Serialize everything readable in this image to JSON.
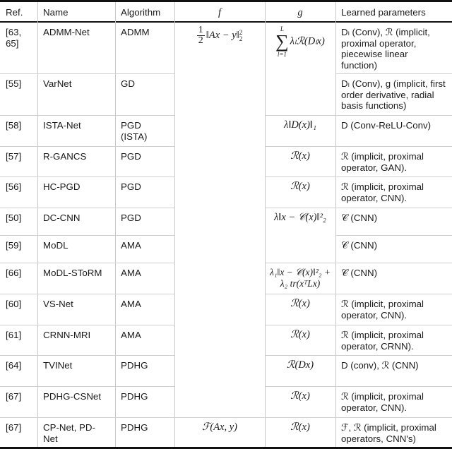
{
  "table": {
    "headers": {
      "ref": "Ref.",
      "name": "Name",
      "algorithm": "Algorithm",
      "f": "f",
      "g": "g",
      "learned": "Learned parameters"
    },
    "f_shared": {
      "frac_num": "1",
      "frac_den": "2",
      "expr": "‖Ax − y‖",
      "sup": "2",
      "sub": "2"
    },
    "rows": [
      {
        "ref": "[63, 65]",
        "name": "ADMM-Net",
        "algorithm": "ADMM",
        "g": {
          "sum_top": "L",
          "sum_bottom": "l=1",
          "expr": "λₗℛ(Dₗx)"
        },
        "learned": "Dₗ (Conv), ℛ (implicit, proximal operator, piecewise linear function)"
      },
      {
        "ref": "[55]",
        "name": "VarNet",
        "algorithm": "GD",
        "learned": "Dₗ (Conv), g (implicit, first order derivative, radial basis functions)"
      },
      {
        "ref": "[58]",
        "name": "ISTA-Net",
        "algorithm": "PGD (ISTA)",
        "g": "λ‖D(x)‖₁",
        "learned": "D (Conv-ReLU-Conv)"
      },
      {
        "ref": "[57]",
        "name": "R-GANCS",
        "algorithm": "PGD",
        "g": "ℛ(x)",
        "learned": "ℛ (implicit, proximal operator, GAN)."
      },
      {
        "ref": "[56]",
        "name": "HC-PGD",
        "algorithm": "PGD",
        "g": "ℛ(x)",
        "learned": "ℛ (implicit, proximal operator, CNN)."
      },
      {
        "ref": "[50]",
        "name": "DC-CNN",
        "algorithm": "PGD",
        "g": "λ‖x − 𝒞(x)‖²₂",
        "learned": "𝒞 (CNN)"
      },
      {
        "ref": "[59]",
        "name": "MoDL",
        "algorithm": "AMA",
        "learned": "𝒞 (CNN)"
      },
      {
        "ref": "[66]",
        "name": "MoDL-SToRM",
        "algorithm": "AMA",
        "g": "λ₁‖x − 𝒞(x)‖²₂ + λ₂ tr(xᵀLx)",
        "learned": "𝒞 (CNN)"
      },
      {
        "ref": "[60]",
        "name": "VS-Net",
        "algorithm": "AMA",
        "g": "ℛ(x)",
        "learned": "ℛ (implicit, proximal operator, CNN)."
      },
      {
        "ref": "[61]",
        "name": "CRNN-MRI",
        "algorithm": "AMA",
        "g": "ℛ(x)",
        "learned": "ℛ (implicit, proximal operator, CRNN)."
      },
      {
        "ref": "[64]",
        "name": "TVINet",
        "algorithm": "PDHG",
        "g": "ℛ(Dx)",
        "learned": "D (conv), ℛ (CNN)"
      },
      {
        "ref": "[67]",
        "name": "PDHG-CSNet",
        "algorithm": "PDHG",
        "g": "ℛ(x)",
        "learned": "ℛ (implicit, proximal operator, CNN)."
      },
      {
        "ref": "[67]",
        "name": "CP-Net, PD-Net",
        "algorithm": "PDHG",
        "f": "ℱ(Ax, y)",
        "g": "ℛ(x)",
        "learned": "ℱ, ℛ (implicit, proximal operators, CNN's)"
      }
    ]
  }
}
